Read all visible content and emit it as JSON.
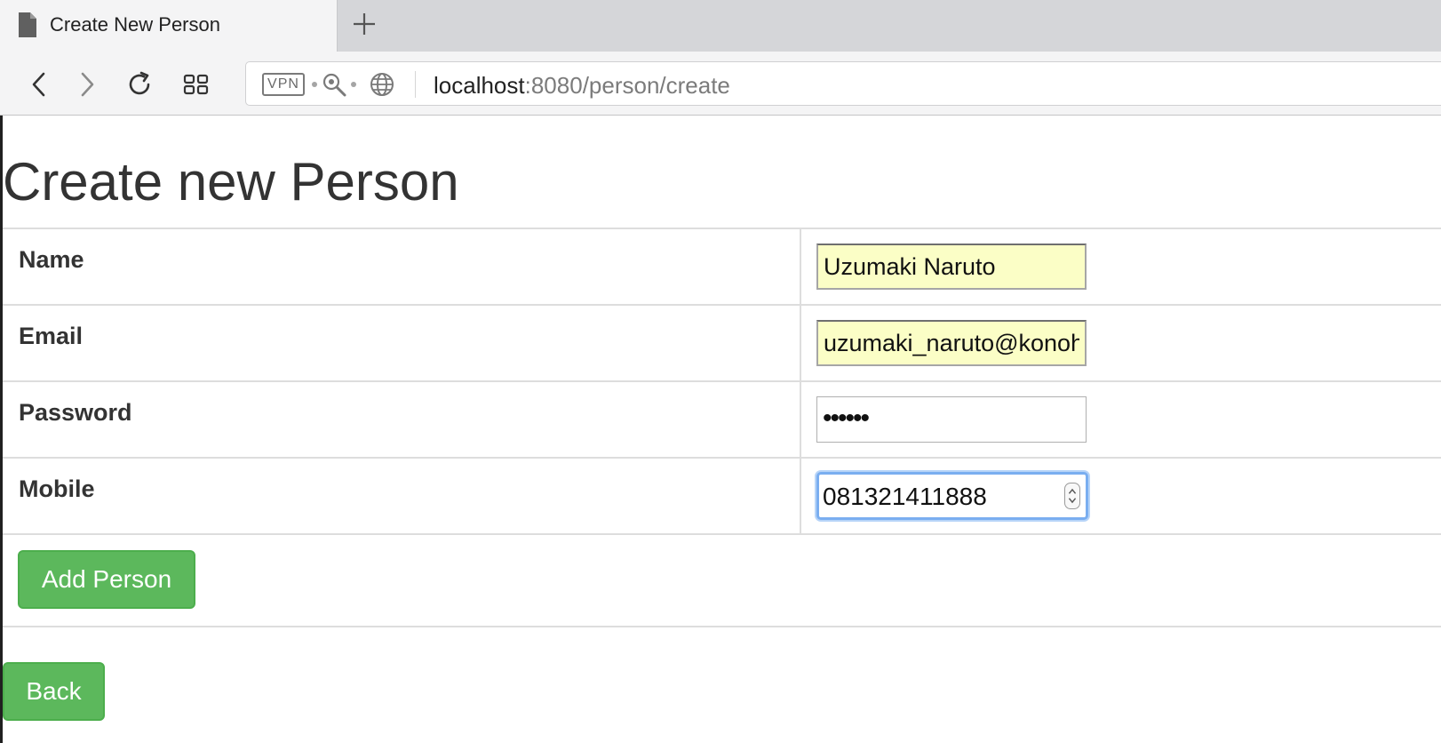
{
  "browser": {
    "tab": {
      "title": "Create New Person",
      "icon": "document-icon"
    },
    "new_tab_icon": "plus-icon",
    "nav": {
      "back": "chevron-left-icon",
      "forward": "chevron-right-icon",
      "reload": "reload-icon",
      "speed_dial": "grid-icon"
    },
    "address": {
      "vpn_badge": "VPN",
      "host": "localhost",
      "path": ":8080/person/create"
    }
  },
  "page": {
    "title": "Create new Person",
    "form": {
      "fields": [
        {
          "label": "Name",
          "value": "Uzumaki Naruto"
        },
        {
          "label": "Email",
          "value": "uzumaki_naruto@konoh"
        },
        {
          "label": "Password",
          "value": "••••••"
        },
        {
          "label": "Mobile",
          "value": "081321411888"
        }
      ],
      "submit_label": "Add Person"
    },
    "back_label": "Back"
  },
  "colors": {
    "button_green": "#5cb85c",
    "autofill_yellow": "#fbfec6",
    "focus_blue": "#7aaef0"
  }
}
